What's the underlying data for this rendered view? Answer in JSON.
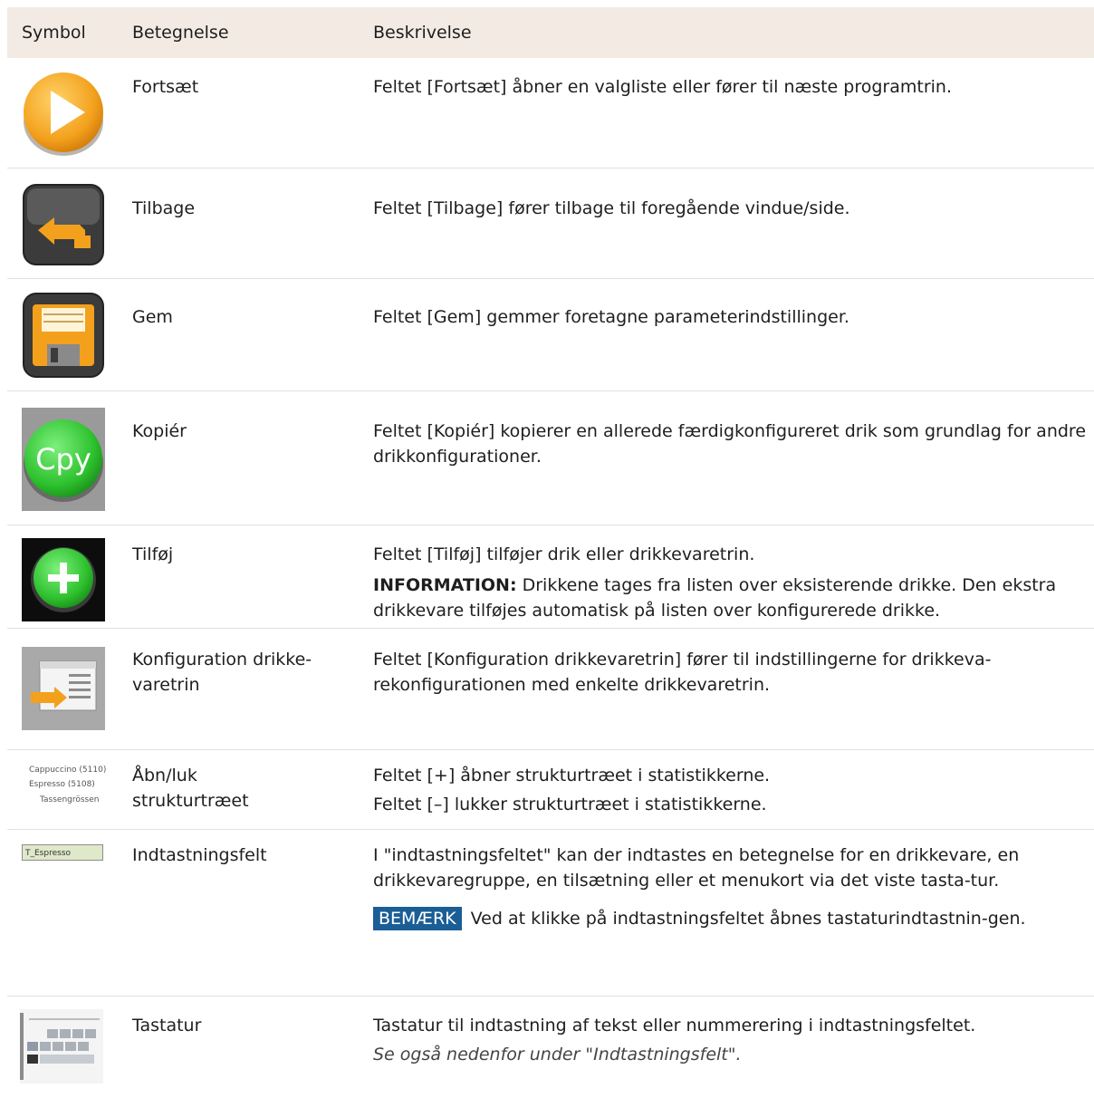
{
  "header": {
    "col_symbol": "Symbol",
    "col_name": "Betegnelse",
    "col_desc": "Beskrivelse"
  },
  "rows": [
    {
      "name": "Fortsæt",
      "desc": "Feltet [Fortsæt] åbner en valgliste eller fører til næste programtrin."
    },
    {
      "name": "Tilbage",
      "desc": "Feltet [Tilbage] fører tilbage til foregående vindue/side."
    },
    {
      "name": "Gem",
      "desc": "Feltet [Gem] gemmer foretagne parameterindstillinger."
    },
    {
      "name": "Kopiér",
      "desc": "Feltet [Kopiér] kopierer en allerede færdigkonfigureret drik som grundlag for andre drikkonfigurationer.",
      "icon_text": "Cpy"
    },
    {
      "name": "Tilføj",
      "desc": "Feltet [Tilføj] tilføjer drik eller drikkevaretrin.",
      "info_label": "INFORMATION:",
      "info_text": " Drikkene tages fra listen over eksisterende drikke. Den ekstra drikkevare tilføjes automatisk på listen over konfigurerede drikke."
    },
    {
      "name": "Konfiguration drikke-varetrin",
      "desc": "Feltet [Konfiguration drikkevaretrin] fører til indstillingerne for drikkeva-rekonfigurationen med enkelte drikkevaretrin."
    },
    {
      "name": "Åbn/luk strukturtræet",
      "desc": "Feltet [+] åbner strukturtræet i statistikkerne.",
      "desc2": "Feltet [–] lukker strukturtræet i statistikkerne.",
      "icon_lines": [
        "Cappuccino (5110)",
        "Espresso (5108)",
        "Tassengrössen"
      ]
    },
    {
      "name": "Indtastningsfelt",
      "desc": "I \"indtastningsfeltet\" kan der indtastes en betegnelse for en drikkevare, en drikkevaregruppe, en tilsætning eller et menukort via det viste tasta-tur.",
      "note_label": "BEMÆRK",
      "note_text": " Ved at klikke på indtastningsfeltet åbnes tastaturindtastnin-gen.",
      "icon_text": "T_Espresso"
    },
    {
      "name": "Tastatur",
      "desc": "Tastatur til indtastning af tekst eller nummerering i indtastningsfeltet.",
      "desc2": "Se også nedenfor under \"Indtastningsfelt\"."
    }
  ],
  "colors": {
    "header_bg": "#f3ebe3",
    "note_badge": "#1b5e96",
    "play_orange": "#f3a11d",
    "green": "#2ec12e"
  },
  "icons": [
    "play-icon",
    "back-arrow-icon",
    "save-disk-icon",
    "copy-cpy-icon",
    "add-plus-icon",
    "configuration-icon",
    "tree-icon",
    "input-field-icon",
    "keyboard-icon"
  ]
}
